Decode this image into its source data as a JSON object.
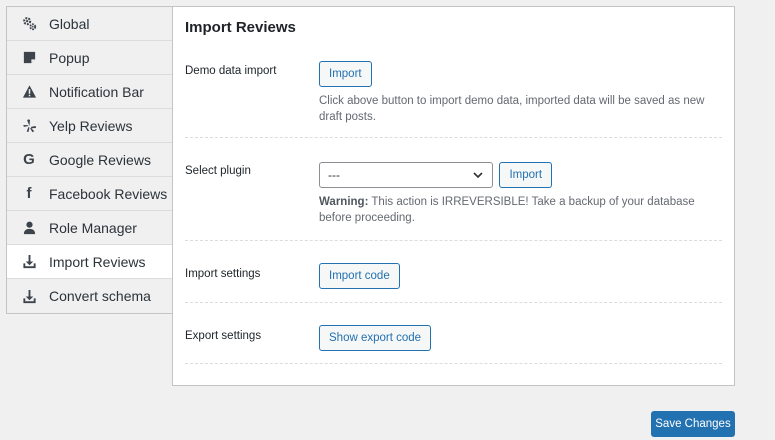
{
  "sidebar": {
    "items": [
      {
        "label": "Global",
        "icon": "gears-icon"
      },
      {
        "label": "Popup",
        "icon": "note-icon"
      },
      {
        "label": "Notification Bar",
        "icon": "warning-icon"
      },
      {
        "label": "Yelp Reviews",
        "icon": "yelp-icon"
      },
      {
        "label": "Google Reviews",
        "icon": "google-icon"
      },
      {
        "label": "Facebook Reviews",
        "icon": "facebook-icon"
      },
      {
        "label": "Role Manager",
        "icon": "user-icon"
      },
      {
        "label": "Import Reviews",
        "icon": "download-icon",
        "active": true
      },
      {
        "label": "Convert schema",
        "icon": "download-icon"
      }
    ]
  },
  "main": {
    "title": "Import Reviews",
    "demo": {
      "label": "Demo data import",
      "button": "Import",
      "description": "Click above button to import demo data, imported data will be saved as new draft posts."
    },
    "select_plugin": {
      "label": "Select plugin",
      "selected": "---",
      "button": "Import",
      "warning_prefix": "Warning:",
      "warning_text": " This action is IRREVERSIBLE! Take a backup of your database before proceeding."
    },
    "import_settings": {
      "label": "Import settings",
      "button": "Import code"
    },
    "export_settings": {
      "label": "Export settings",
      "button": "Show export code"
    }
  },
  "footer": {
    "save_label": "Save Changes"
  },
  "colors": {
    "accent": "#2271b1",
    "background": "#f0f0f1",
    "panel": "#ffffff"
  }
}
